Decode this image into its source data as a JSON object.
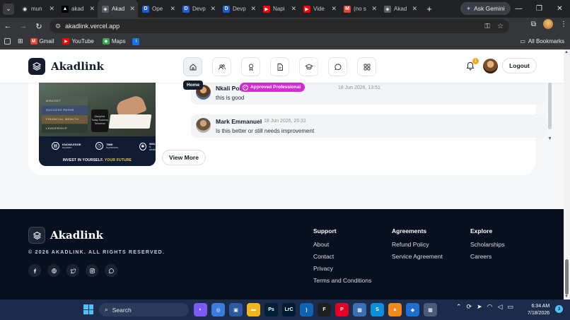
{
  "browser": {
    "tabs": [
      {
        "label": "mun",
        "favicon": "github-icon",
        "color": "#24292f",
        "glyph": "◉"
      },
      {
        "label": "akad",
        "favicon": "vercel-icon",
        "color": "#000000",
        "glyph": "▲"
      },
      {
        "label": "Akad",
        "favicon": "akadlink-icon",
        "color": "#5a5d63",
        "glyph": "◈"
      },
      {
        "label": "Ope",
        "favicon": "devpost-icon",
        "color": "#1e5bd6",
        "glyph": "D"
      },
      {
        "label": "Devp",
        "favicon": "devpost-icon",
        "color": "#1e5bd6",
        "glyph": "D"
      },
      {
        "label": "Devp",
        "favicon": "devpost-icon",
        "color": "#1e5bd6",
        "glyph": "D"
      },
      {
        "label": "Napi",
        "favicon": "youtube-icon",
        "color": "#ff0000",
        "glyph": "▶"
      },
      {
        "label": "Vide",
        "favicon": "youtube-icon",
        "color": "#ff0000",
        "glyph": "▶"
      },
      {
        "label": "(no s",
        "favicon": "gmail-icon",
        "color": "#ea4335",
        "glyph": "M"
      },
      {
        "label": "Akad",
        "favicon": "akadlink-icon",
        "color": "#5a5d63",
        "glyph": "◈"
      }
    ],
    "active_tab": 2,
    "new_tab": "+",
    "gemini_label": "Ask Gemini",
    "url": "akadlink.vercel.app",
    "bookmarks": [
      {
        "label": "Gmail",
        "icon": "gmail-icon",
        "color": "#ea4335",
        "glyph": "M"
      },
      {
        "label": "YouTube",
        "icon": "youtube-icon",
        "color": "#ff0000",
        "glyph": "▶"
      },
      {
        "label": "Maps",
        "icon": "maps-icon",
        "color": "#34a853",
        "glyph": "◆"
      }
    ],
    "all_bookmarks": "All Bookmarks"
  },
  "header": {
    "logo_text": "Akadlink",
    "nav_icons": [
      "home-icon",
      "users-icon",
      "award-icon",
      "document-icon",
      "graduation-cap-icon",
      "chat-icon",
      "grid-icon"
    ],
    "active_nav": 0,
    "tooltip": "Home",
    "notification_count": "1",
    "logout_label": "Logout"
  },
  "card": {
    "image": {
      "books": [
        "MINDSET",
        "SUCCESS PATHS",
        "FINANCIAL WEALTH",
        "LEADERSHIP"
      ],
      "mug_text": "Discipline Today Success Tomorrow",
      "banner_items": [
        {
          "title": "KNOWLEDGE",
          "sub": "is power.",
          "icon": "book-icon"
        },
        {
          "title": "TIME",
          "sub": "is precious.",
          "icon": "clock-icon"
        },
        {
          "title": "SKILL",
          "sub": "is wealth.",
          "icon": "gear-icon"
        }
      ],
      "footer_main": "INVEST IN YOURSELF.",
      "footer_accent": "YOUR FUTURE"
    },
    "comments": [
      {
        "name": "Nkali Polycarp",
        "badge": "Approved Professional",
        "time": "18 Jun 2026, 13:51",
        "text": "this is good"
      },
      {
        "name": "Mark Emmanuel",
        "time": "18 Jun 2026, 20:31",
        "text": "Is this better or still needs improvement"
      }
    ],
    "view_more": "View More"
  },
  "footer": {
    "logo_text": "Akadlink",
    "copyright": "© 2026 AKADLINK. ALL RIGHTS RESERVED.",
    "socials": [
      "facebook-icon",
      "globe-icon",
      "twitter-icon",
      "instagram-icon",
      "whatsapp-icon"
    ],
    "columns": [
      {
        "heading": "Support",
        "links": [
          "About",
          "Contact",
          "Privacy",
          "Terms and Conditions"
        ]
      },
      {
        "heading": "Agreements",
        "links": [
          "Refund Policy",
          "Service Agreement"
        ]
      },
      {
        "heading": "Explore",
        "links": [
          "Scholarships",
          "Careers"
        ]
      }
    ]
  },
  "taskbar": {
    "search_label": "Search",
    "apps": [
      {
        "name": "copilot-icon",
        "color": "#7a5af5",
        "glyph": "◐"
      },
      {
        "name": "chrome-icon",
        "color": "#3b7ddd",
        "glyph": "◎"
      },
      {
        "name": "task-view-icon",
        "color": "#2c5aa0",
        "glyph": "▣"
      },
      {
        "name": "file-explorer-icon",
        "color": "#f2b71d",
        "glyph": "▬"
      },
      {
        "name": "photoshop-icon",
        "color": "#001e36",
        "glyph": "Ps"
      },
      {
        "name": "lightroom-icon",
        "color": "#001a33",
        "glyph": "LrC"
      },
      {
        "name": "vscode-icon",
        "color": "#0e63b3",
        "glyph": "⟩"
      },
      {
        "name": "figma-icon",
        "color": "#1e1e1e",
        "glyph": "F"
      },
      {
        "name": "pinterest-icon",
        "color": "#e60023",
        "glyph": "P"
      },
      {
        "name": "photos-icon",
        "color": "#3a6fb5",
        "glyph": "▩"
      },
      {
        "name": "skype-icon",
        "color": "#0a8fd8",
        "glyph": "S"
      },
      {
        "name": "vlc-icon",
        "color": "#f28a1a",
        "glyph": "▲"
      },
      {
        "name": "defender-icon",
        "color": "#1f6fd1",
        "glyph": "◆"
      },
      {
        "name": "store-icon",
        "color": "#4a5a78",
        "glyph": "▦"
      }
    ],
    "time": "6:34 AM",
    "date": "7/18/2026",
    "notifications": "3"
  }
}
